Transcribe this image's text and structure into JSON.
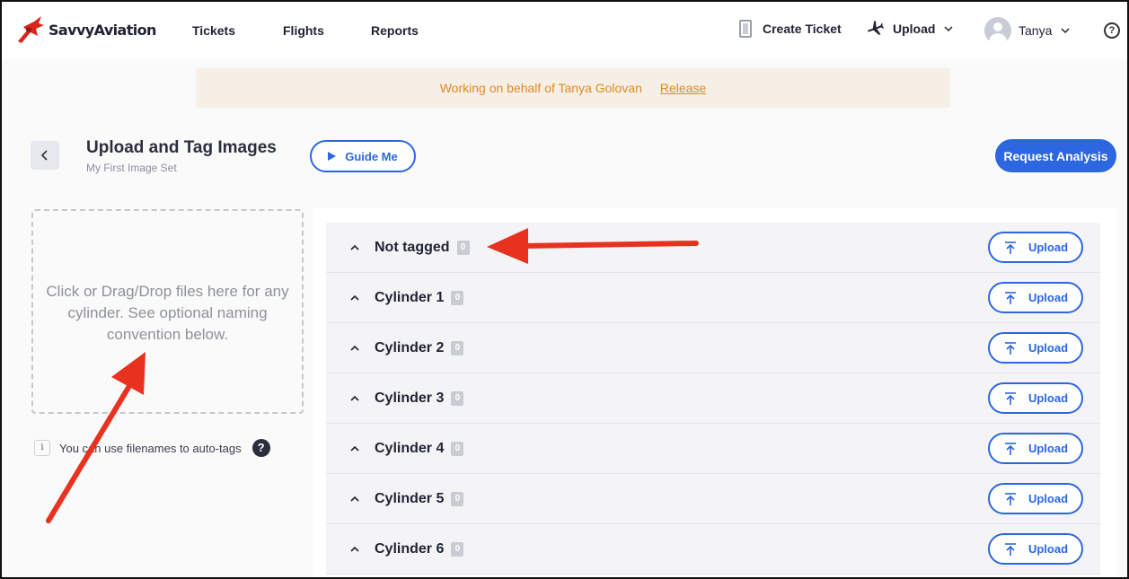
{
  "nav": {
    "brand": "SavvyAviation",
    "links": [
      "Tickets",
      "Flights",
      "Reports"
    ],
    "create_ticket": "Create Ticket",
    "upload": "Upload",
    "user": "Tanya"
  },
  "banner": {
    "text": "Working on behalf of Tanya Golovan",
    "link": "Release"
  },
  "header": {
    "title": "Upload and Tag Images",
    "subtitle": "My First Image Set",
    "guide_label": "Guide Me",
    "request_label": "Request Analysis"
  },
  "dropzone": {
    "text": "Click or Drag/Drop files here for any cylinder. See optional naming convention below."
  },
  "hint": {
    "text": "You can use filenames to auto-tags",
    "info_glyph": "i",
    "help_glyph": "?"
  },
  "tags": [
    {
      "name": "Not tagged",
      "count": "0",
      "action": "Upload"
    },
    {
      "name": "Cylinder 1",
      "count": "0",
      "action": "Upload"
    },
    {
      "name": "Cylinder 2",
      "count": "0",
      "action": "Upload"
    },
    {
      "name": "Cylinder 3",
      "count": "0",
      "action": "Upload"
    },
    {
      "name": "Cylinder 4",
      "count": "0",
      "action": "Upload"
    },
    {
      "name": "Cylinder 5",
      "count": "0",
      "action": "Upload"
    },
    {
      "name": "Cylinder 6",
      "count": "0",
      "action": "Upload"
    }
  ],
  "colors": {
    "accent": "#2c66e0",
    "banner_text": "#e08a1e",
    "banner_bg": "#f6efe6",
    "annotation_arrow": "#e8321f"
  }
}
